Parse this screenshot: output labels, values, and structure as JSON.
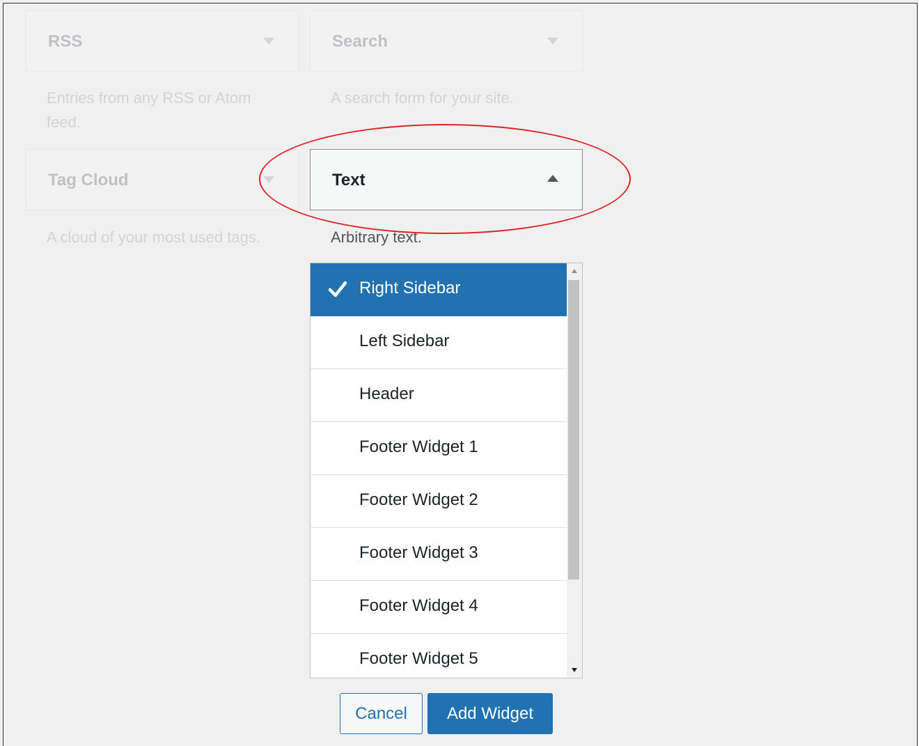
{
  "widgets": [
    {
      "title": "RSS",
      "description": "Entries from any RSS or Atom feed."
    },
    {
      "title": "Search",
      "description": "A search form for your site."
    },
    {
      "title": "Tag Cloud",
      "description": "A cloud of your most used tags."
    },
    {
      "title": "Text",
      "description": "Arbitrary text."
    }
  ],
  "sidebar_options": [
    "Right Sidebar",
    "Left Sidebar",
    "Header",
    "Footer Widget 1",
    "Footer Widget 2",
    "Footer Widget 3",
    "Footer Widget 4",
    "Footer Widget 5"
  ],
  "selected_option": "Right Sidebar",
  "buttons": {
    "cancel": "Cancel",
    "add_widget": "Add Widget"
  },
  "colors": {
    "accent": "#2271b1",
    "annotation": "#e02424"
  }
}
